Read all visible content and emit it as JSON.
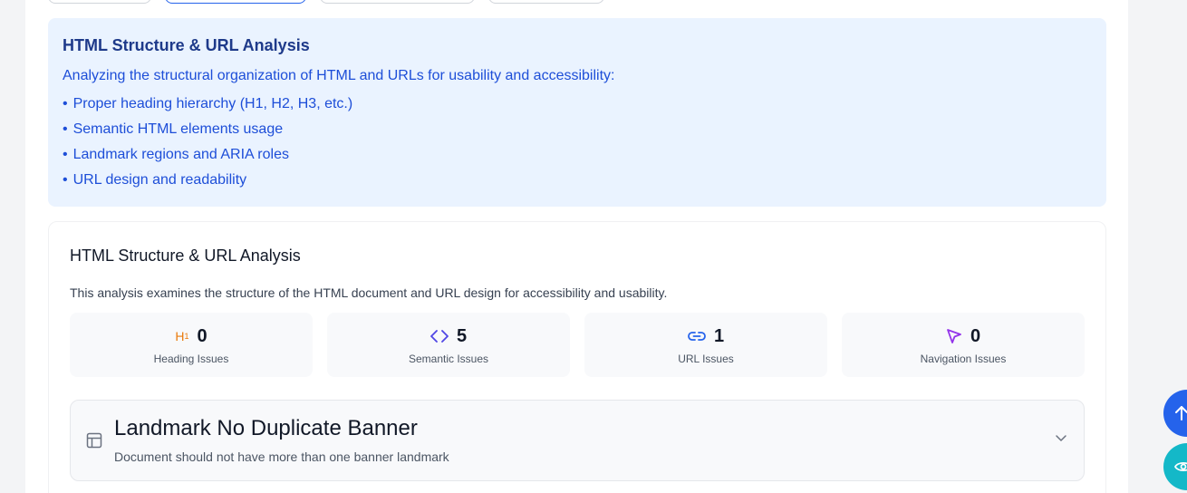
{
  "info": {
    "title": "HTML Structure & URL Analysis",
    "description": "Analyzing the structural organization of HTML and URLs for usability and accessibility:",
    "items": [
      "Proper heading hierarchy (H1, H2, H3, etc.)",
      "Semantic HTML elements usage",
      "Landmark regions and ARIA roles",
      "URL design and readability"
    ]
  },
  "card": {
    "title": "HTML Structure & URL Analysis",
    "description": "This analysis examines the structure of the HTML document and URL design for accessibility and usability.",
    "stats": [
      {
        "icon": "heading-icon",
        "value": "0",
        "label": "Heading Issues",
        "color": "#ea7a0c"
      },
      {
        "icon": "code-icon",
        "value": "5",
        "label": "Semantic Issues",
        "color": "#4f46e5"
      },
      {
        "icon": "link-icon",
        "value": "1",
        "label": "URL Issues",
        "color": "#2563eb"
      },
      {
        "icon": "cursor-icon",
        "value": "0",
        "label": "Navigation Issues",
        "color": "#9333ea"
      }
    ]
  },
  "issue": {
    "icon": "layout-icon",
    "title": "Landmark No Duplicate Banner",
    "description": "Document should not have more than one banner landmark"
  },
  "fabs": {
    "up_icon": "arrow-up-icon",
    "eye_icon": "eye-icon"
  },
  "bullet": "•"
}
